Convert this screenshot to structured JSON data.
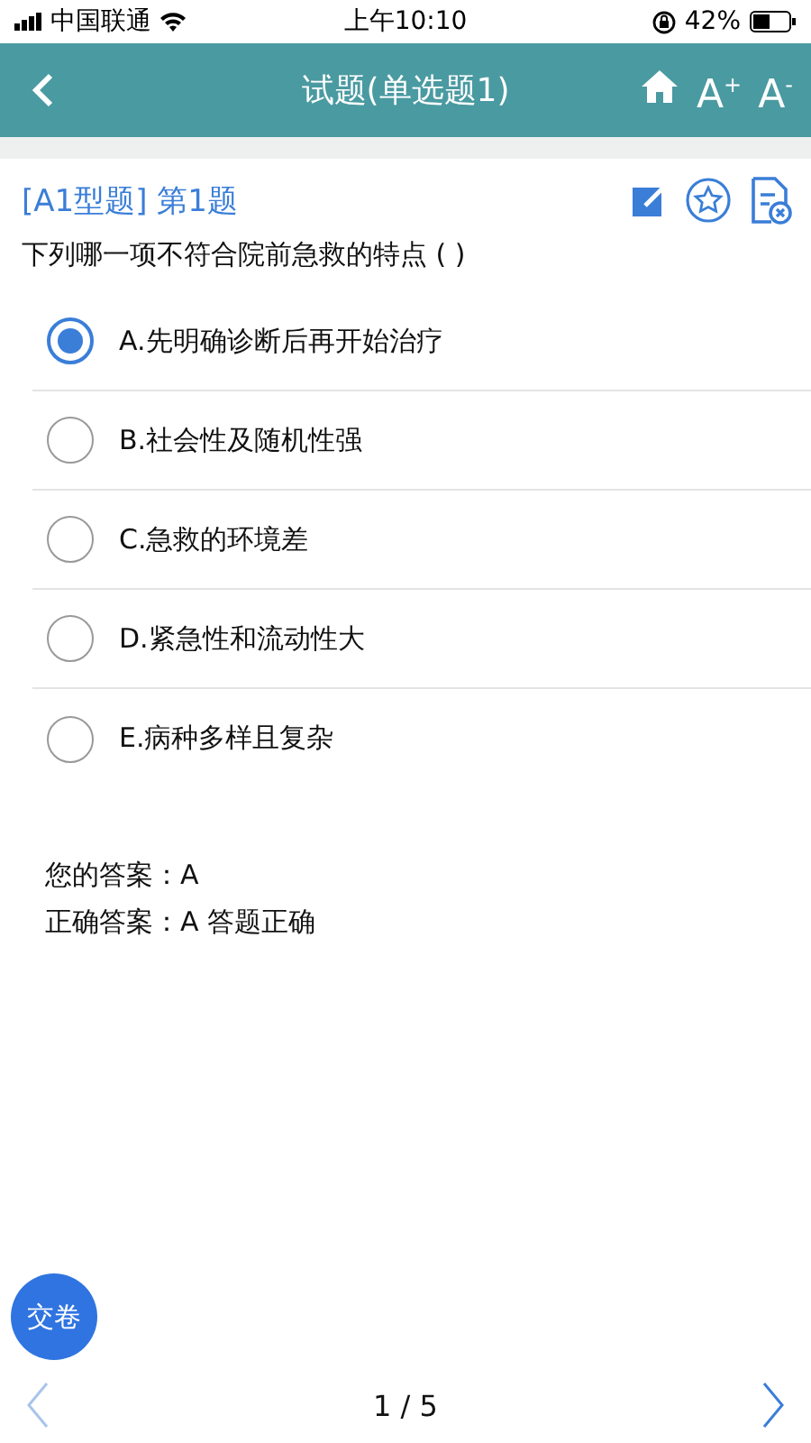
{
  "status_bar": {
    "carrier": "中国联通",
    "time": "上午10:10",
    "battery": "42%"
  },
  "header": {
    "title": "试题(单选题1)",
    "font_larger": "A$^{+}$",
    "font_smaller": "A$^{-}$"
  },
  "question": {
    "type_label": "[A1型题] 第1题",
    "stem": "下列哪一项不符合院前急救的特点 ( )",
    "options": [
      {
        "label": "A.先明确诊断后再开始治疗",
        "selected": true
      },
      {
        "label": "B.社会性及随机性强",
        "selected": false
      },
      {
        "label": "C.急救的环境差",
        "selected": false
      },
      {
        "label": "D.紧急性和流动性大",
        "selected": false
      },
      {
        "label": "E.病种多样且复杂",
        "selected": false
      }
    ],
    "your_answer": "您的答案：A",
    "correct_answer": "正确答案：A 答题正确"
  },
  "submit_button": "交卷",
  "pager": {
    "position": "1 / 5"
  }
}
